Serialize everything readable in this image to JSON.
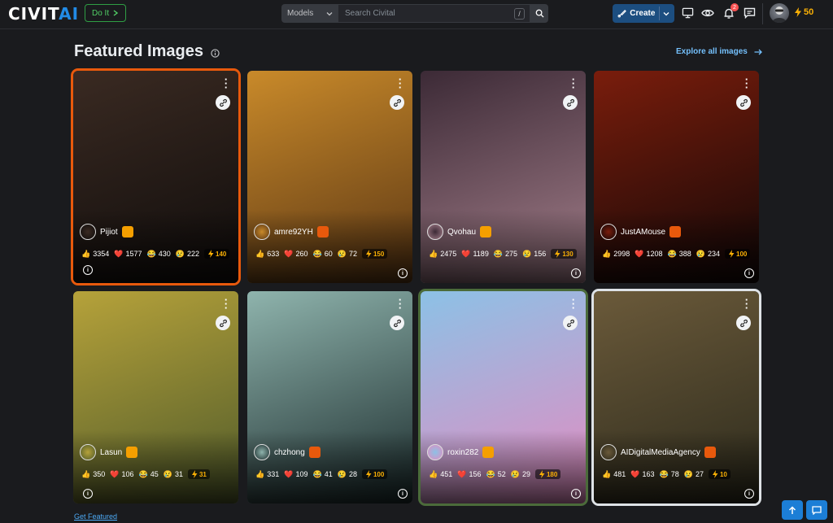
{
  "header": {
    "logo_main": "CIVIT",
    "logo_accent": "AI",
    "doit_label": "Do It",
    "search_scope": "Models",
    "search_placeholder": "Search Civital",
    "search_shortcut": "/",
    "create_label": "Create",
    "notification_count": "2",
    "buzz_balance": "50"
  },
  "section": {
    "title": "Featured Images",
    "explore_label": "Explore all images",
    "get_featured": "Get Featured"
  },
  "cards": [
    {
      "user": "Pijiot",
      "likes": "3354",
      "hearts": "1577",
      "laughs": "430",
      "cries": "222",
      "buzz": "140",
      "colors": [
        "#3a2a22",
        "#0f0c0b"
      ]
    },
    {
      "user": "amre92YH",
      "likes": "633",
      "hearts": "260",
      "laughs": "60",
      "cries": "72",
      "buzz": "150",
      "colors": [
        "#c98a2a",
        "#5a3614"
      ]
    },
    {
      "user": "Qvohau",
      "likes": "2475",
      "hearts": "1189",
      "laughs": "275",
      "cries": "156",
      "buzz": "130",
      "colors": [
        "#3c2a36",
        "#a37e8a"
      ]
    },
    {
      "user": "JustAMouse",
      "likes": "2998",
      "hearts": "1208",
      "laughs": "388",
      "cries": "234",
      "buzz": "100",
      "colors": [
        "#7a1d0c",
        "#110707"
      ]
    },
    {
      "user": "Lasun",
      "likes": "350",
      "hearts": "106",
      "laughs": "45",
      "cries": "31",
      "buzz": "31",
      "colors": [
        "#b6a23a",
        "#4f5a2a"
      ]
    },
    {
      "user": "chzhong",
      "likes": "331",
      "hearts": "109",
      "laughs": "41",
      "cries": "28",
      "buzz": "100",
      "colors": [
        "#8fb4ad",
        "#1b2b2c"
      ]
    },
    {
      "user": "roxin282",
      "likes": "451",
      "hearts": "156",
      "laughs": "52",
      "cries": "29",
      "buzz": "180",
      "colors": [
        "#8cc1e6",
        "#e48bc0"
      ]
    },
    {
      "user": "AIDigitalMediaAgency",
      "likes": "481",
      "hearts": "163",
      "laughs": "78",
      "cries": "27",
      "buzz": "10",
      "colors": [
        "#6b5a3a",
        "#2c2a1c"
      ]
    }
  ]
}
